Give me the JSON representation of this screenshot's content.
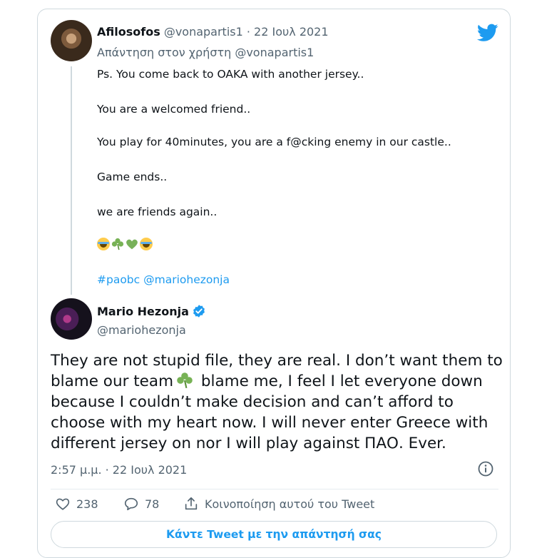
{
  "quoted_tweet": {
    "author_name": "Afilosofos",
    "meta": "@vonapartis1 · 22 Ιουλ 2021",
    "reply_to": "Απάντηση στον χρήστη @vonapartis1",
    "lines": [
      "Ps. You come back to OAKA with another jersey..",
      "You are a welcomed friend..",
      "You play for 40minutes, you are a f@cking enemy in our castle..",
      "Game ends..",
      "we are friends again.."
    ],
    "emojis": [
      "joy-emoji",
      "shamrock-emoji",
      "green-heart-emoji",
      "joy-emoji"
    ],
    "hashtag": "#paobc",
    "mention": "@mariohezonja"
  },
  "main_tweet": {
    "author_name": "Mario Hezonja",
    "handle": "@mariohezonja",
    "text_lines": [
      "They are not stupid file, they are real. I don’t want them to",
      "blame our team",
      " blame me, I feel I let everyone down",
      "because I couldn’t make decision and can’t afford to",
      "choose with my heart now. I will never enter Greece with",
      "different jersey on nor I will play against ΠΑΟ. Ever."
    ],
    "timestamp": "2:57 μ.μ. · 22 Ιουλ 2021",
    "likes": "238",
    "replies": "78",
    "share_label": "Κοινοποίηση αυτού του Tweet",
    "reply_button_label": "Κάντε Tweet με την απάντησή σας"
  },
  "colors": {
    "accent": "#1d9bf0",
    "text": "#0f1419",
    "muted": "#536471",
    "border": "#cfd9de"
  },
  "icons": [
    "twitter-logo-icon",
    "verified-badge-icon",
    "info-icon",
    "heart-icon",
    "reply-bubble-icon",
    "share-icon"
  ]
}
